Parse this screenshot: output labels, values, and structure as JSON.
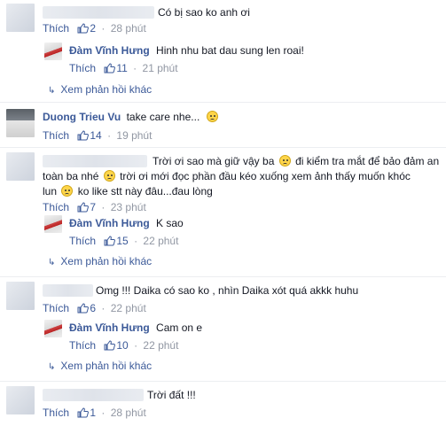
{
  "actions": {
    "like": "Thích",
    "more_replies": "Xem phản hồi khác"
  },
  "comments": [
    {
      "text": "Có bị sao ko anh ơi",
      "likes": "2",
      "time": "28 phút",
      "reply": {
        "author": "Đàm Vĩnh Hưng",
        "text": "Hinh nhu bat dau sung len roai!",
        "likes": "11",
        "time": "21 phút"
      }
    },
    {
      "author": "Duong Trieu Vu",
      "text": "take care nhe...",
      "likes": "14",
      "time": "19 phút"
    },
    {
      "lines": [
        "Trời ơi sao mà giữ vậy ba",
        "đi kiểm tra mắt để bảo đảm an",
        "toàn ba nhé",
        "trời ơi mới đọc phần đầu kéo xuống xem ảnh thấy muốn khóc",
        "lun",
        "ko like stt này đâu...đau lòng"
      ],
      "likes": "7",
      "time": "23 phút",
      "reply": {
        "author": "Đàm Vĩnh Hưng",
        "text": "K sao",
        "likes": "15",
        "time": "22 phút"
      }
    },
    {
      "text": "Omg !!! Daika có sao ko , nhìn Daika xót quá akkk huhu",
      "likes": "6",
      "time": "22 phút",
      "reply": {
        "author": "Đàm Vĩnh Hưng",
        "text": "Cam on e",
        "likes": "10",
        "time": "22 phút"
      }
    },
    {
      "text": "Trời đất !!!",
      "likes": "1",
      "time": "28 phút"
    }
  ],
  "colors": {
    "link": "#3b5998",
    "meta": "#9197a3",
    "text": "#141823"
  },
  "icons": {
    "like": "thumbs-up-icon",
    "reply_arrow": "reply-arrow-icon",
    "emoji": "frown-emoji-icon"
  }
}
